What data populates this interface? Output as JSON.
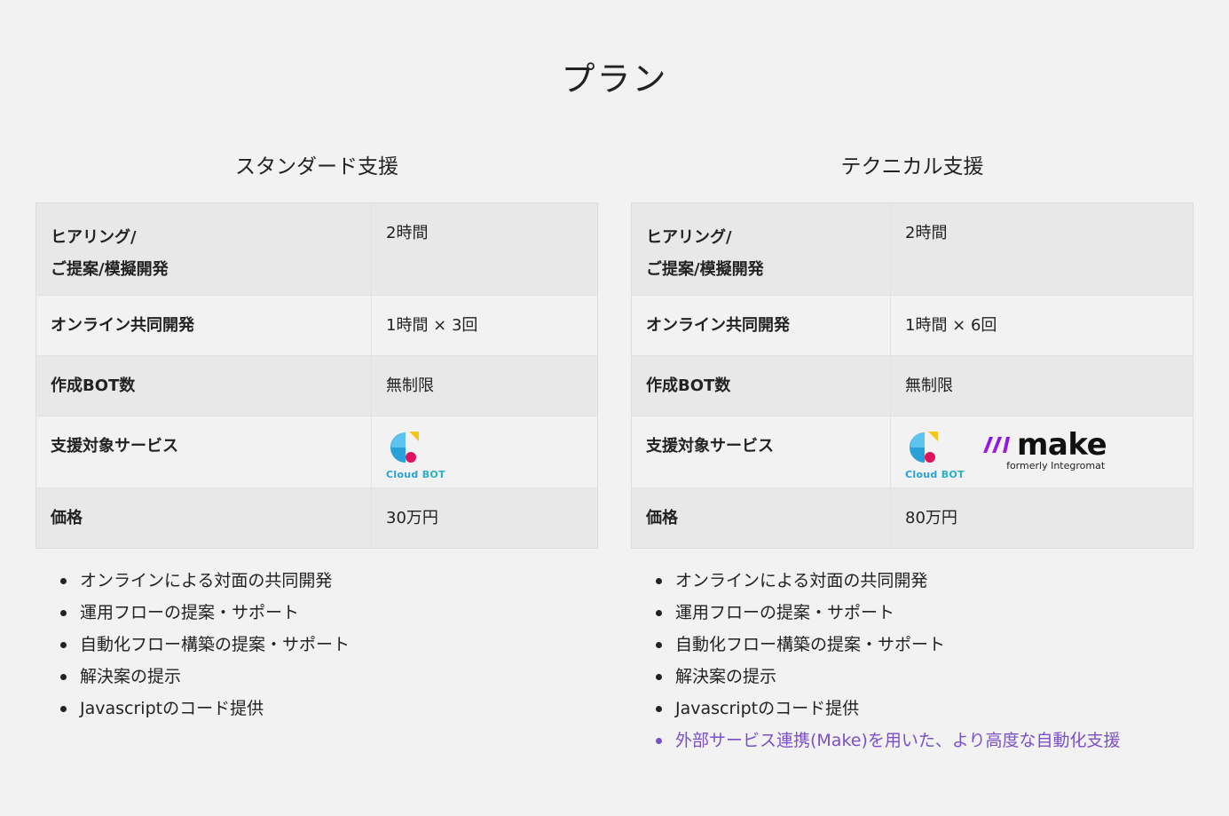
{
  "page": {
    "title": "プラン"
  },
  "colors": {
    "background": "#f2f2f2",
    "row_shade": "#e8e8e8",
    "highlight": "#7b4fc8",
    "cloudbot_blue": "#2aa0d8",
    "cloudbot_yellow": "#f5c518",
    "cloudbot_pink": "#e0115f",
    "make_purple": "#9b1fe8"
  },
  "plans": [
    {
      "title": "スタンダード支援",
      "rows": [
        {
          "label_line1": "ヒアリング/",
          "label_line2": "ご提案/模擬開発",
          "value": "2時間"
        },
        {
          "label": "オンライン共同開発",
          "value": "1時間 × 3回"
        },
        {
          "label": "作成BOT数",
          "value": "無制限"
        },
        {
          "label": "支援対象サービス",
          "logos": [
            "cloudbot-logo"
          ]
        },
        {
          "label": "価格",
          "value": "30万円"
        }
      ],
      "features": [
        "オンラインによる対面の共同開発",
        "運用フローの提案・サポート",
        "自動化フロー構築の提案・サポート",
        "解決案の提示",
        "Javascriptのコード提供"
      ]
    },
    {
      "title": "テクニカル支援",
      "rows": [
        {
          "label_line1": "ヒアリング/",
          "label_line2": "ご提案/模擬開発",
          "value": "2時間"
        },
        {
          "label": "オンライン共同開発",
          "value": "1時間 × 6回"
        },
        {
          "label": "作成BOT数",
          "value": "無制限"
        },
        {
          "label": "支援対象サービス",
          "logos": [
            "cloudbot-logo",
            "make-logo"
          ]
        },
        {
          "label": "価格",
          "value": "80万円"
        }
      ],
      "features": [
        "オンラインによる対面の共同開発",
        "運用フローの提案・サポート",
        "自動化フロー構築の提案・サポート",
        "解決案の提示",
        "Javascriptのコード提供"
      ],
      "extra_feature": "外部サービス連携(Make)を用いた、より高度な自動化支援"
    }
  ],
  "logos": {
    "cloudbot": {
      "word1": "Cloud",
      "word2": "BOT"
    },
    "make": {
      "word": "make",
      "sub": "formerly Integromat"
    }
  }
}
